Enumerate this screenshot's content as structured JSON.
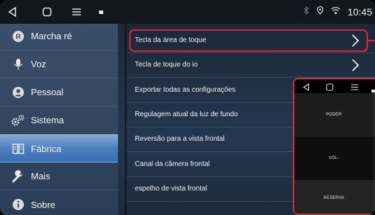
{
  "statusbar": {
    "nav": [
      "back-icon",
      "home-icon",
      "menu-icon",
      "small-square-icon"
    ],
    "icons": [
      "bluetooth-icon",
      "location-icon",
      "wifi-icon"
    ],
    "time": "10:45"
  },
  "sidebar": {
    "items": [
      {
        "label": "Marcha ré",
        "icon": "reverse-r-icon",
        "active": false
      },
      {
        "label": "Voz",
        "icon": "microphone-icon",
        "active": false
      },
      {
        "label": "Pessoal",
        "icon": "person-icon",
        "active": false
      },
      {
        "label": "Sistema",
        "icon": "gears-icon",
        "active": false
      },
      {
        "label": "Fábrica",
        "icon": "factory-icon",
        "active": true
      },
      {
        "label": "Mais",
        "icon": "wrench-icon",
        "active": false
      },
      {
        "label": "Sobre",
        "icon": "info-icon",
        "active": false
      }
    ]
  },
  "main": {
    "rows": [
      {
        "label": "Tecla da área de toque",
        "chevron": true
      },
      {
        "label": "Tecla de toque do io",
        "chevron": true
      },
      {
        "label": "Exportar todas as configurações",
        "chevron": false
      },
      {
        "label": "Regulagem atual da luz de fundo",
        "chevron": false
      },
      {
        "label": "Reversão para a vista frontal",
        "chevron": false
      },
      {
        "label": "Canal da câmera frontal",
        "chevron": false
      },
      {
        "label": "espelho de vista frontal",
        "chevron": false
      }
    ]
  },
  "overlay": {
    "buttons": [
      "PODER",
      "VOL-",
      "RESERVA"
    ]
  },
  "colors": {
    "highlight": "#e22533",
    "active_item": "#4d7fbf"
  }
}
